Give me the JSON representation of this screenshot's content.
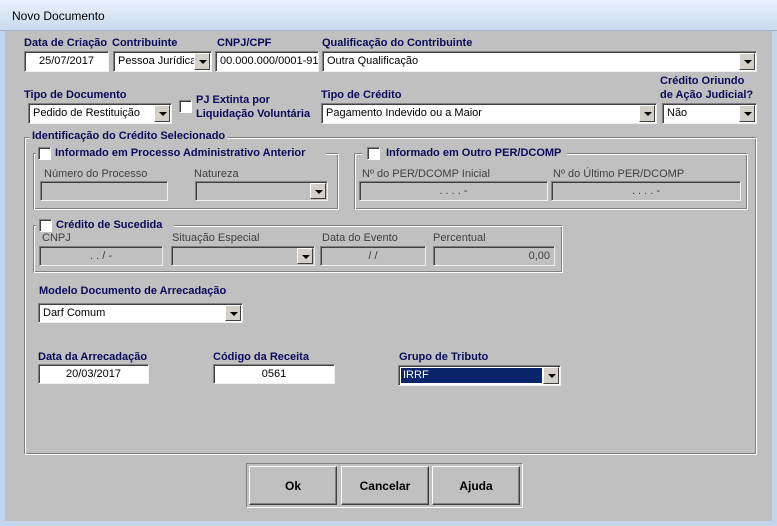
{
  "window": {
    "title": "Novo Documento"
  },
  "row1": {
    "data_criacao_label": "Data de Criação",
    "data_criacao_value": "25/07/2017",
    "contribuinte_label": "Contribuinte",
    "contribuinte_value": "Pessoa Jurídica",
    "cnpj_label": "CNPJ/CPF",
    "cnpj_value": "00.000.000/0001-91",
    "qualificacao_label": "Qualificação do Contribuinte",
    "qualificacao_value": "Outra Qualificação"
  },
  "row2": {
    "tipo_documento_label": "Tipo de Documento",
    "tipo_documento_value": "Pedido de Restituição",
    "pj_extinta_label_line1": "PJ Extinta por",
    "pj_extinta_label_line2": "Liquidação Voluntária",
    "tipo_credito_label": "Tipo de Crédito",
    "tipo_credito_value": "Pagamento Indevido ou a Maior",
    "credito_oriundo_label_line1": "Crédito Oriundo",
    "credito_oriundo_label_line2": "de Ação Judicial?",
    "credito_oriundo_value": "Não"
  },
  "identificacao": {
    "title": "Identificação do Crédito Selecionado",
    "processo_adm": {
      "checkbox_label": "Informado em Processo Administrativo Anterior",
      "numero_label": "Número do Processo",
      "natureza_label": "Natureza"
    },
    "outro_perdcomp": {
      "checkbox_label": "Informado em Outro PER/DCOMP",
      "inicial_label": "Nº do PER/DCOMP Inicial",
      "inicial_value": ". . . . -",
      "ultimo_label": "Nº do Último PER/DCOMP",
      "ultimo_value": ". . . . -"
    },
    "sucedida": {
      "checkbox_label": "Crédito de Sucedida",
      "cnpj_label": "CNPJ",
      "cnpj_value": ". . / -",
      "situacao_label": "Situação Especial",
      "data_evento_label": "Data do Evento",
      "data_evento_value": "/ /",
      "percentual_label": "Percentual",
      "percentual_value": "0,00"
    },
    "modelo": {
      "label": "Modelo Documento de Arrecadação",
      "value": "Darf Comum"
    },
    "arrecadacao": {
      "data_label": "Data da Arrecadação",
      "data_value": "20/03/2017",
      "codigo_label": "Código da Receita",
      "codigo_value": "0561",
      "grupo_label": "Grupo de Tributo",
      "grupo_value": "IRRF"
    }
  },
  "buttons": {
    "ok": "Ok",
    "cancelar": "Cancelar",
    "ajuda": "Ajuda"
  }
}
